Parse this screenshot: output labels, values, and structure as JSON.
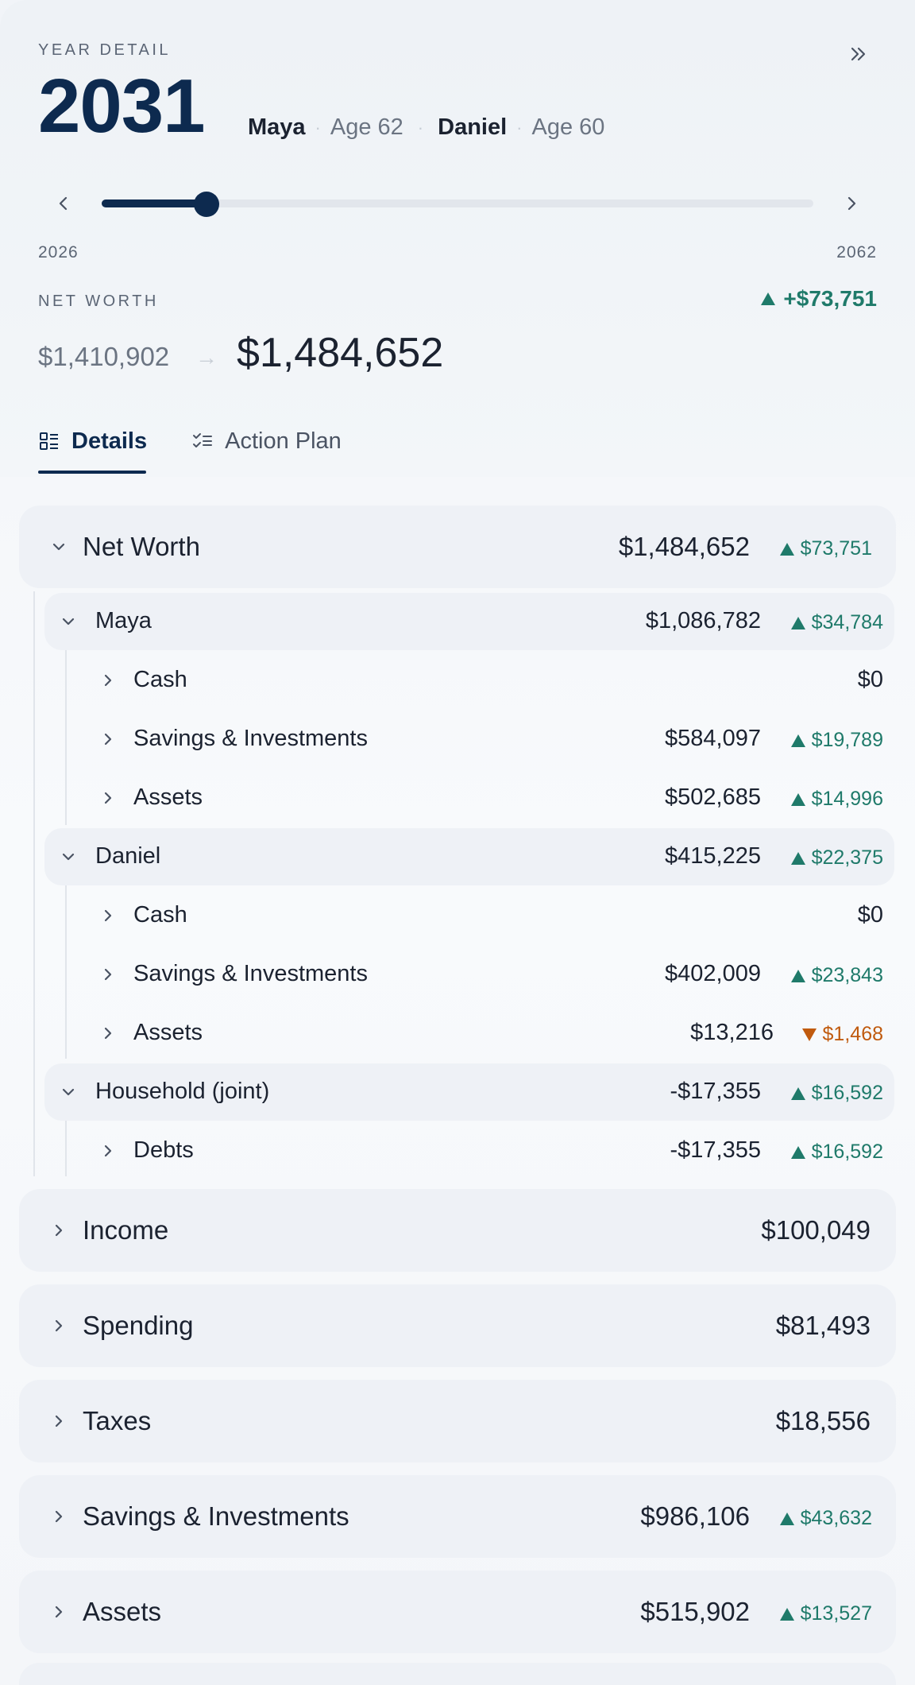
{
  "header": {
    "eyebrow": "YEAR DETAIL",
    "year": "2031",
    "persons": [
      {
        "name": "Maya",
        "age": "Age 62"
      },
      {
        "name": "Daniel",
        "age": "Age 60"
      }
    ],
    "slider": {
      "min": "2026",
      "max": "2062",
      "value": 2031
    },
    "net_worth_label": "NET WORTH",
    "net_worth_delta": "+$73,751",
    "net_worth_prev": "$1,410,902",
    "net_worth_arrow": "→",
    "net_worth_current": "$1,484,652"
  },
  "tabs": [
    {
      "label": "Details",
      "icon": "details-icon",
      "active": true
    },
    {
      "label": "Action Plan",
      "icon": "checklist-icon",
      "active": false
    }
  ],
  "net_worth_card": {
    "title": "Net Worth",
    "value": "$1,484,652",
    "delta": "$73,751"
  },
  "groups": [
    {
      "name": "Maya",
      "value": "$1,086,782",
      "delta": "$34,784",
      "dir": "up",
      "items": [
        {
          "label": "Cash",
          "value": "$0",
          "delta": "",
          "dir": ""
        },
        {
          "label": "Savings & Investments",
          "value": "$584,097",
          "delta": "$19,789",
          "dir": "up"
        },
        {
          "label": "Assets",
          "value": "$502,685",
          "delta": "$14,996",
          "dir": "up"
        }
      ]
    },
    {
      "name": "Daniel",
      "value": "$415,225",
      "delta": "$22,375",
      "dir": "up",
      "items": [
        {
          "label": "Cash",
          "value": "$0",
          "delta": "",
          "dir": ""
        },
        {
          "label": "Savings & Investments",
          "value": "$402,009",
          "delta": "$23,843",
          "dir": "up"
        },
        {
          "label": "Assets",
          "value": "$13,216",
          "delta": "$1,468",
          "dir": "down"
        }
      ]
    },
    {
      "name": "Household (joint)",
      "value": "-$17,355",
      "delta": "$16,592",
      "dir": "up",
      "items": [
        {
          "label": "Debts",
          "value": "-$17,355",
          "delta": "$16,592",
          "dir": "up"
        }
      ]
    }
  ],
  "sections": [
    {
      "title": "Income",
      "value": "$100,049",
      "delta": ""
    },
    {
      "title": "Spending",
      "value": "$81,493",
      "delta": ""
    },
    {
      "title": "Taxes",
      "value": "$18,556",
      "delta": ""
    },
    {
      "title": "Savings & Investments",
      "value": "$986,106",
      "delta": "$43,632"
    },
    {
      "title": "Assets",
      "value": "$515,902",
      "delta": "$13,527"
    }
  ],
  "colors": {
    "accent": "#0d2a4f",
    "positive": "#1f7a6a",
    "negative": "#c05a0e"
  }
}
